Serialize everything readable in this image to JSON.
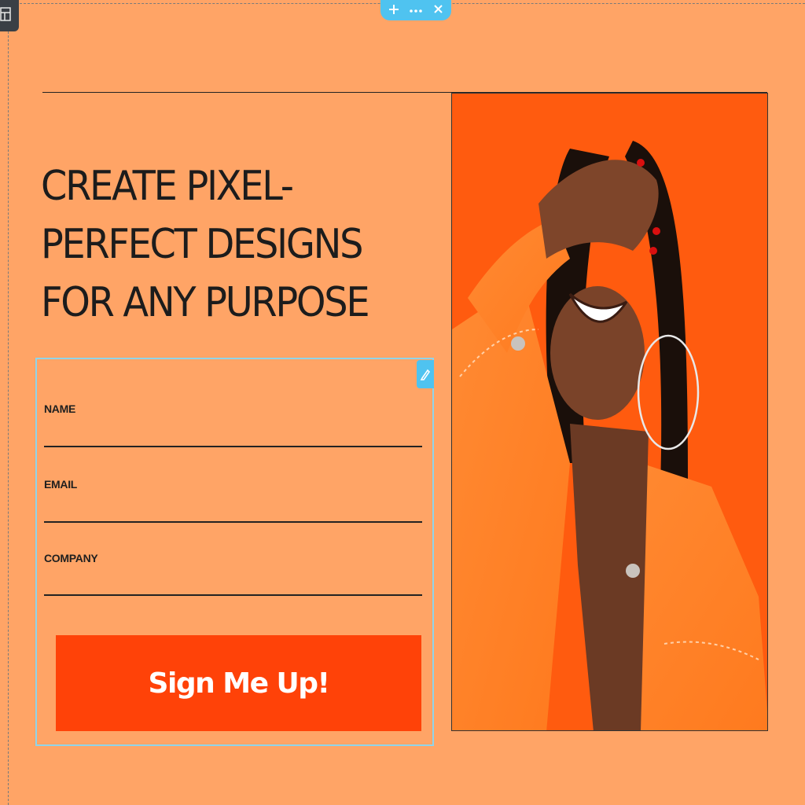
{
  "editor": {
    "toolbar": {
      "move_icon": "move-icon",
      "more_icon": "more-icon",
      "close_icon": "close-icon"
    },
    "corner_icon": "layout-icon",
    "edit_icon": "pencil-icon"
  },
  "hero": {
    "headline": "CREATE PIXEL-PERFECT DESIGNS FOR ANY PURPOSE"
  },
  "form": {
    "name_label": "NAME",
    "email_label": "EMAIL",
    "company_label": "COMPANY",
    "submit_label": "Sign Me Up!"
  },
  "image": {
    "description_icon": "photo-woman-laughing-orange-jacket"
  },
  "colors": {
    "background": "#ffa466",
    "button": "#ff4208",
    "image_bg": "#ff5b0f",
    "selection": "#4fc3f0"
  }
}
